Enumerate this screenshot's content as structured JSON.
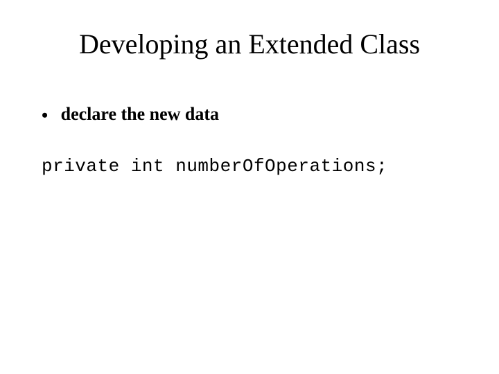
{
  "title": "Developing an Extended Class",
  "bullet": {
    "marker": "•",
    "text": "declare the new data"
  },
  "code": "private int numberOfOperations;"
}
